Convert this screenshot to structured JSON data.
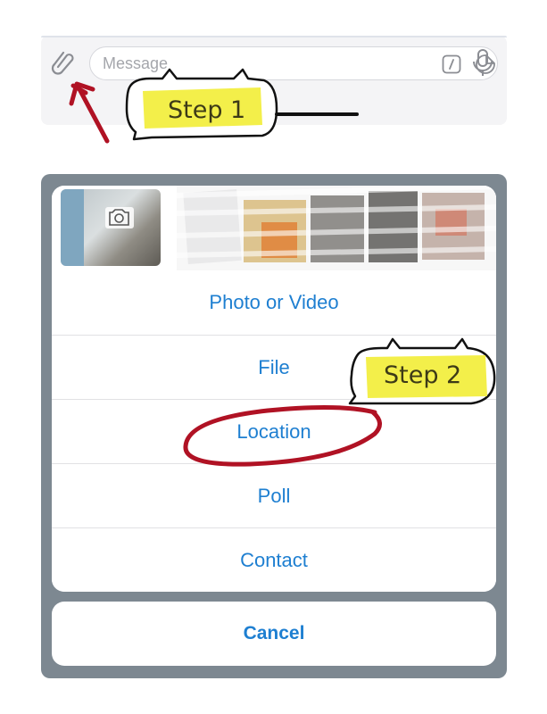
{
  "input_bar": {
    "placeholder": "Message",
    "icons": [
      "paperclip-icon",
      "command-icon",
      "sticker-icon",
      "microphone-icon"
    ]
  },
  "attachment_sheet": {
    "options": [
      {
        "label": "Photo or Video"
      },
      {
        "label": "File"
      },
      {
        "label": "Location"
      },
      {
        "label": "Poll"
      },
      {
        "label": "Contact"
      }
    ],
    "cancel_label": "Cancel",
    "accent_color": "#1e7fd1"
  },
  "annotations": {
    "step1": "Step 1",
    "step2": "Step 2",
    "highlight_color": "#f3ef4a",
    "marker_color": "#b01224"
  }
}
